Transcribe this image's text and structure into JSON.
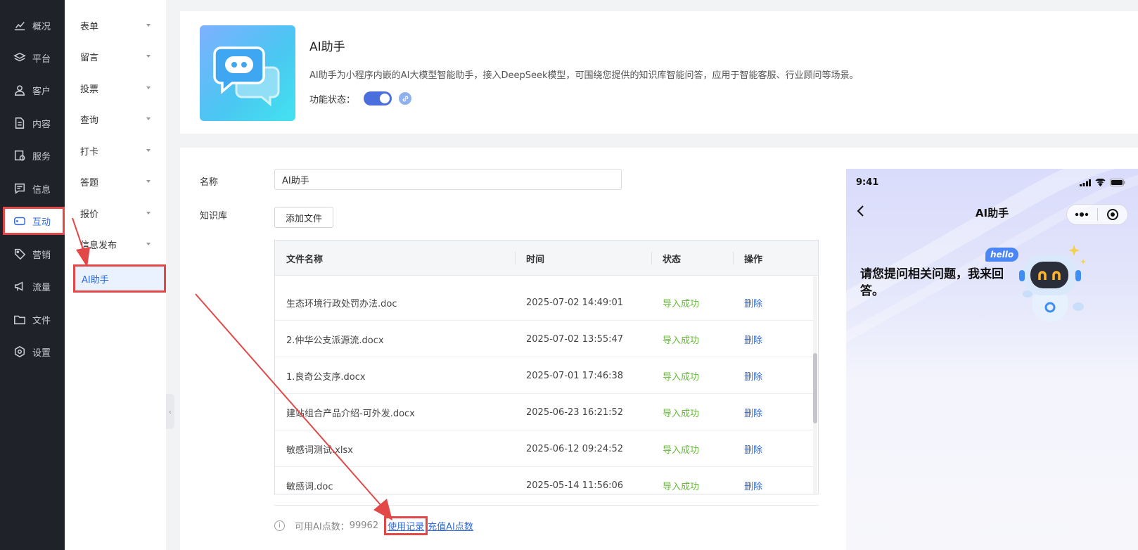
{
  "nav": {
    "items": [
      {
        "label": "概况",
        "icon": "chart-line-icon"
      },
      {
        "label": "平台",
        "icon": "layers-icon"
      },
      {
        "label": "客户",
        "icon": "user-icon"
      },
      {
        "label": "内容",
        "icon": "document-icon"
      },
      {
        "label": "服务",
        "icon": "service-icon"
      },
      {
        "label": "信息",
        "icon": "message-icon"
      },
      {
        "label": "互动",
        "icon": "gamepad-icon",
        "active": true
      },
      {
        "label": "营销",
        "icon": "tag-icon"
      },
      {
        "label": "流量",
        "icon": "megaphone-icon"
      },
      {
        "label": "文件",
        "icon": "folder-icon"
      },
      {
        "label": "设置",
        "icon": "gear-icon"
      }
    ]
  },
  "submenu": {
    "items": [
      {
        "label": "表单"
      },
      {
        "label": "留言"
      },
      {
        "label": "投票"
      },
      {
        "label": "查询"
      },
      {
        "label": "打卡"
      },
      {
        "label": "答题"
      },
      {
        "label": "报价"
      },
      {
        "label": "信息发布"
      },
      {
        "label": "AI助手",
        "active": true
      }
    ]
  },
  "header": {
    "title": "AI助手",
    "description": "AI助手为小程序内嵌的AI大模型智能助手，接入DeepSeek模型，可围绕您提供的知识库智能问答，应用于智能客服、行业顾问等场景。",
    "status_label": "功能状态：",
    "status_on": true
  },
  "form": {
    "name_label": "名称",
    "name_value": "AI助手",
    "kb_label": "知识库",
    "add_file_label": "添加文件"
  },
  "table": {
    "columns": [
      "文件名称",
      "时间",
      "状态",
      "操作"
    ],
    "rows": [
      {
        "name": "生态环境行政处罚办法.doc",
        "time": "2025-07-02 14:49:01",
        "status": "导入成功",
        "action": "删除"
      },
      {
        "name": "2.仲华公支派源流.docx",
        "time": "2025-07-02 13:55:47",
        "status": "导入成功",
        "action": "删除"
      },
      {
        "name": "1.良奇公支序.docx",
        "time": "2025-07-01 17:46:38",
        "status": "导入成功",
        "action": "删除"
      },
      {
        "name": "建站组合产品介绍-可外发.docx",
        "time": "2025-06-23 16:21:52",
        "status": "导入成功",
        "action": "删除"
      },
      {
        "name": "敏感词测试.xlsx",
        "time": "2025-06-12 09:24:52",
        "status": "导入成功",
        "action": "删除"
      },
      {
        "name": "敏感词.doc",
        "time": "2025-05-14 11:56:06",
        "status": "导入成功",
        "action": "删除"
      }
    ]
  },
  "footer": {
    "points_label": "可用AI点数：",
    "points_value": "99962",
    "usage_link": "使用记录",
    "recharge_link": "充值AI点数"
  },
  "phone": {
    "time": "9:41",
    "title": "AI助手",
    "greeting": "请您提问相关问题，我来回答。",
    "hello": "hello"
  },
  "colors": {
    "accent": "#2f6bdf",
    "success": "#67b83a",
    "highlight": "#e24848",
    "nav_bg": "#1f2229"
  }
}
